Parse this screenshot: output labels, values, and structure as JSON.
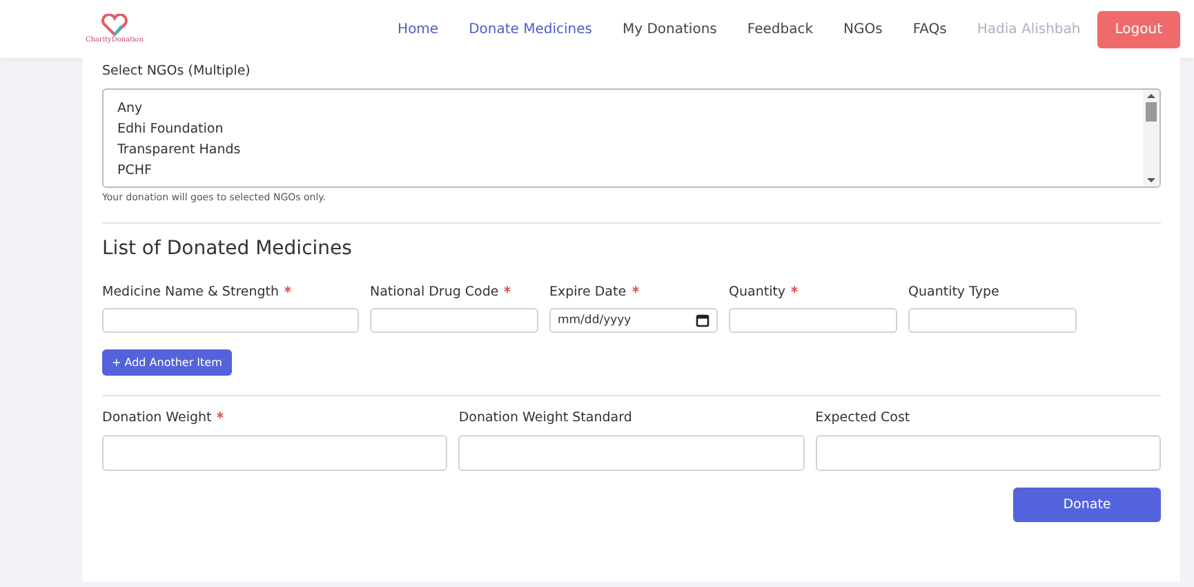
{
  "header": {
    "logo_text": "CharityDonation",
    "nav": [
      {
        "label": "Home",
        "selected": true
      },
      {
        "label": "Donate Medicines",
        "selected": true
      },
      {
        "label": "My Donations",
        "selected": false
      },
      {
        "label": "Feedback",
        "selected": false
      },
      {
        "label": "NGOs",
        "selected": false
      },
      {
        "label": "FAQs",
        "selected": false
      }
    ],
    "user_name": "Hadia Alishbah",
    "logout": "Logout"
  },
  "ngo_select": {
    "label": "Select NGOs (Multiple)",
    "options": [
      "Any",
      "Edhi Foundation",
      "Transparent Hands",
      "PCHF"
    ],
    "help": "Your donation will goes to selected NGOs only."
  },
  "medicines": {
    "title": "List of Donated Medicines",
    "fields": [
      {
        "label": "Medicine Name & Strength",
        "required": true,
        "kind": "text"
      },
      {
        "label": "National Drug Code",
        "required": true,
        "kind": "text"
      },
      {
        "label": "Expire Date",
        "required": true,
        "kind": "date",
        "placeholder": "mm/dd/yyyy"
      },
      {
        "label": "Quantity",
        "required": true,
        "kind": "text"
      },
      {
        "label": "Quantity Type",
        "required": false,
        "kind": "text"
      }
    ],
    "add_button": "+ Add Another Item"
  },
  "donation": {
    "fields": [
      {
        "label": "Donation Weight",
        "required": true
      },
      {
        "label": "Donation Weight Standard",
        "required": false
      },
      {
        "label": "Expected Cost",
        "required": false
      }
    ],
    "submit": "Donate"
  }
}
